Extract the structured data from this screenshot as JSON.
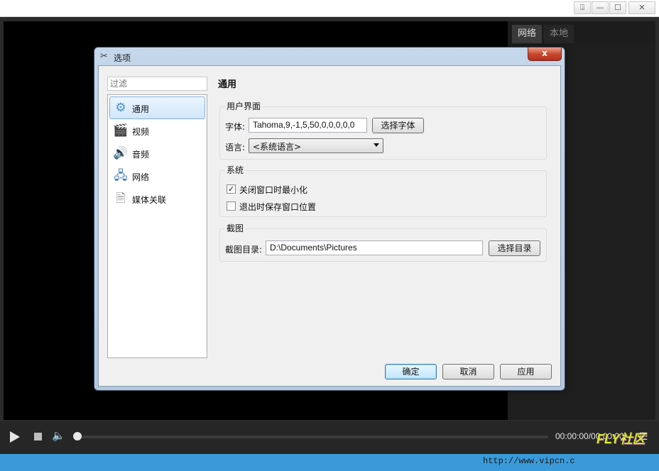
{
  "player": {
    "titlebar_buttons": {
      "menu": "⍗",
      "minimize": "—",
      "maximize": "☐",
      "close": "✕"
    },
    "side_tabs": [
      {
        "label": "网络",
        "active": true
      },
      {
        "label": "本地",
        "active": false
      }
    ],
    "controls": {
      "time": "00:00:00/00:00:00",
      "volume_icon": "🔈",
      "playlist_icon": "☰"
    }
  },
  "dialog": {
    "title": "选项",
    "title_icon": "✂",
    "close_label": "x",
    "filter_placeholder": "过滤",
    "nav": [
      {
        "label": "通用",
        "icon": "gear-icon",
        "glyph": "⚙",
        "color": "#4a90c8",
        "selected": true
      },
      {
        "label": "视频",
        "icon": "clapperboard-icon",
        "glyph": "🎬",
        "color": "#333333",
        "selected": false
      },
      {
        "label": "音频",
        "icon": "speaker-icon",
        "glyph": "🔊",
        "color": "#777777",
        "selected": false
      },
      {
        "label": "网络",
        "icon": "network-icon",
        "glyph": "🖧",
        "color": "#2f6fb8",
        "selected": false
      },
      {
        "label": "媒体关联",
        "icon": "media-association-icon",
        "glyph": "🗎",
        "color": "#888888",
        "selected": false
      }
    ],
    "section_title": "通用",
    "groups": {
      "ui": {
        "title": "用户界面",
        "font_label": "字体:",
        "font_value": "Tahoma,9,-1,5,50,0,0,0,0,0",
        "font_button": "选择字体",
        "language_label": "语言:",
        "language_value": "<系统语言>"
      },
      "system": {
        "title": "系统",
        "options": [
          {
            "label": "关闭窗口时最小化",
            "checked": true
          },
          {
            "label": "退出时保存窗口位置",
            "checked": false
          }
        ]
      },
      "screenshot": {
        "title": "截图",
        "dir_label": "截图目录:",
        "dir_value": "D:\\Documents\\Pictures",
        "dir_button": "选择目录"
      }
    },
    "buttons": {
      "ok": "确定",
      "cancel": "取消",
      "apply": "应用"
    }
  },
  "watermark": {
    "url": "http://www.vipcn.c",
    "brand": "FLY社区"
  }
}
